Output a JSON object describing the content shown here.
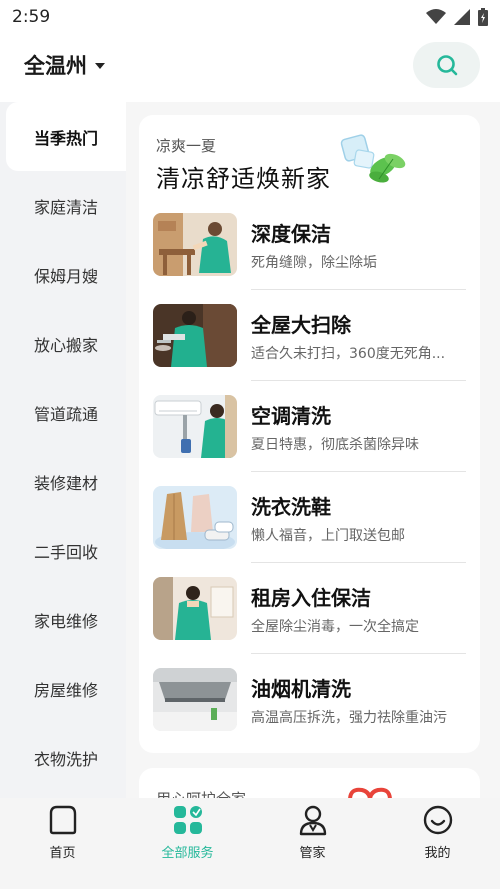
{
  "status_bar": {
    "time": "2:59"
  },
  "header": {
    "city": "全温州"
  },
  "sidebar": {
    "items": [
      {
        "label": "当季热门",
        "active": true
      },
      {
        "label": "家庭清洁",
        "active": false
      },
      {
        "label": "保姆月嫂",
        "active": false
      },
      {
        "label": "放心搬家",
        "active": false
      },
      {
        "label": "管道疏通",
        "active": false
      },
      {
        "label": "装修建材",
        "active": false
      },
      {
        "label": "二手回收",
        "active": false
      },
      {
        "label": "家电维修",
        "active": false
      },
      {
        "label": "房屋维修",
        "active": false
      },
      {
        "label": "衣物洗护",
        "active": false
      }
    ]
  },
  "banner": {
    "subtitle": "凉爽一夏",
    "title": "清凉舒适焕新家"
  },
  "services": [
    {
      "name": "深度保洁",
      "desc": "死角缝隙，除尘除垢"
    },
    {
      "name": "全屋大扫除",
      "desc": "适合久未打扫，360度无死角..."
    },
    {
      "name": "空调清洗",
      "desc": "夏日特惠，彻底杀菌除异味"
    },
    {
      "name": "洗衣洗鞋",
      "desc": "懒人福音，上门取送包邮"
    },
    {
      "name": "租房入住保洁",
      "desc": "全屋除尘消毒，一次全搞定"
    },
    {
      "name": "油烟机清洗",
      "desc": "高温高压拆洗，强力祛除重油污"
    }
  ],
  "section2": {
    "title": "用心呵护全家"
  },
  "bottom_nav": [
    {
      "label": "首页",
      "icon": "home-icon"
    },
    {
      "label": "全部服务",
      "icon": "grid-icon",
      "active": true
    },
    {
      "label": "管家",
      "icon": "person-icon"
    },
    {
      "label": "我的",
      "icon": "smile-icon"
    }
  ],
  "colors": {
    "accent": "#25b89a",
    "background": "#f2f3f5",
    "card": "#ffffff"
  }
}
